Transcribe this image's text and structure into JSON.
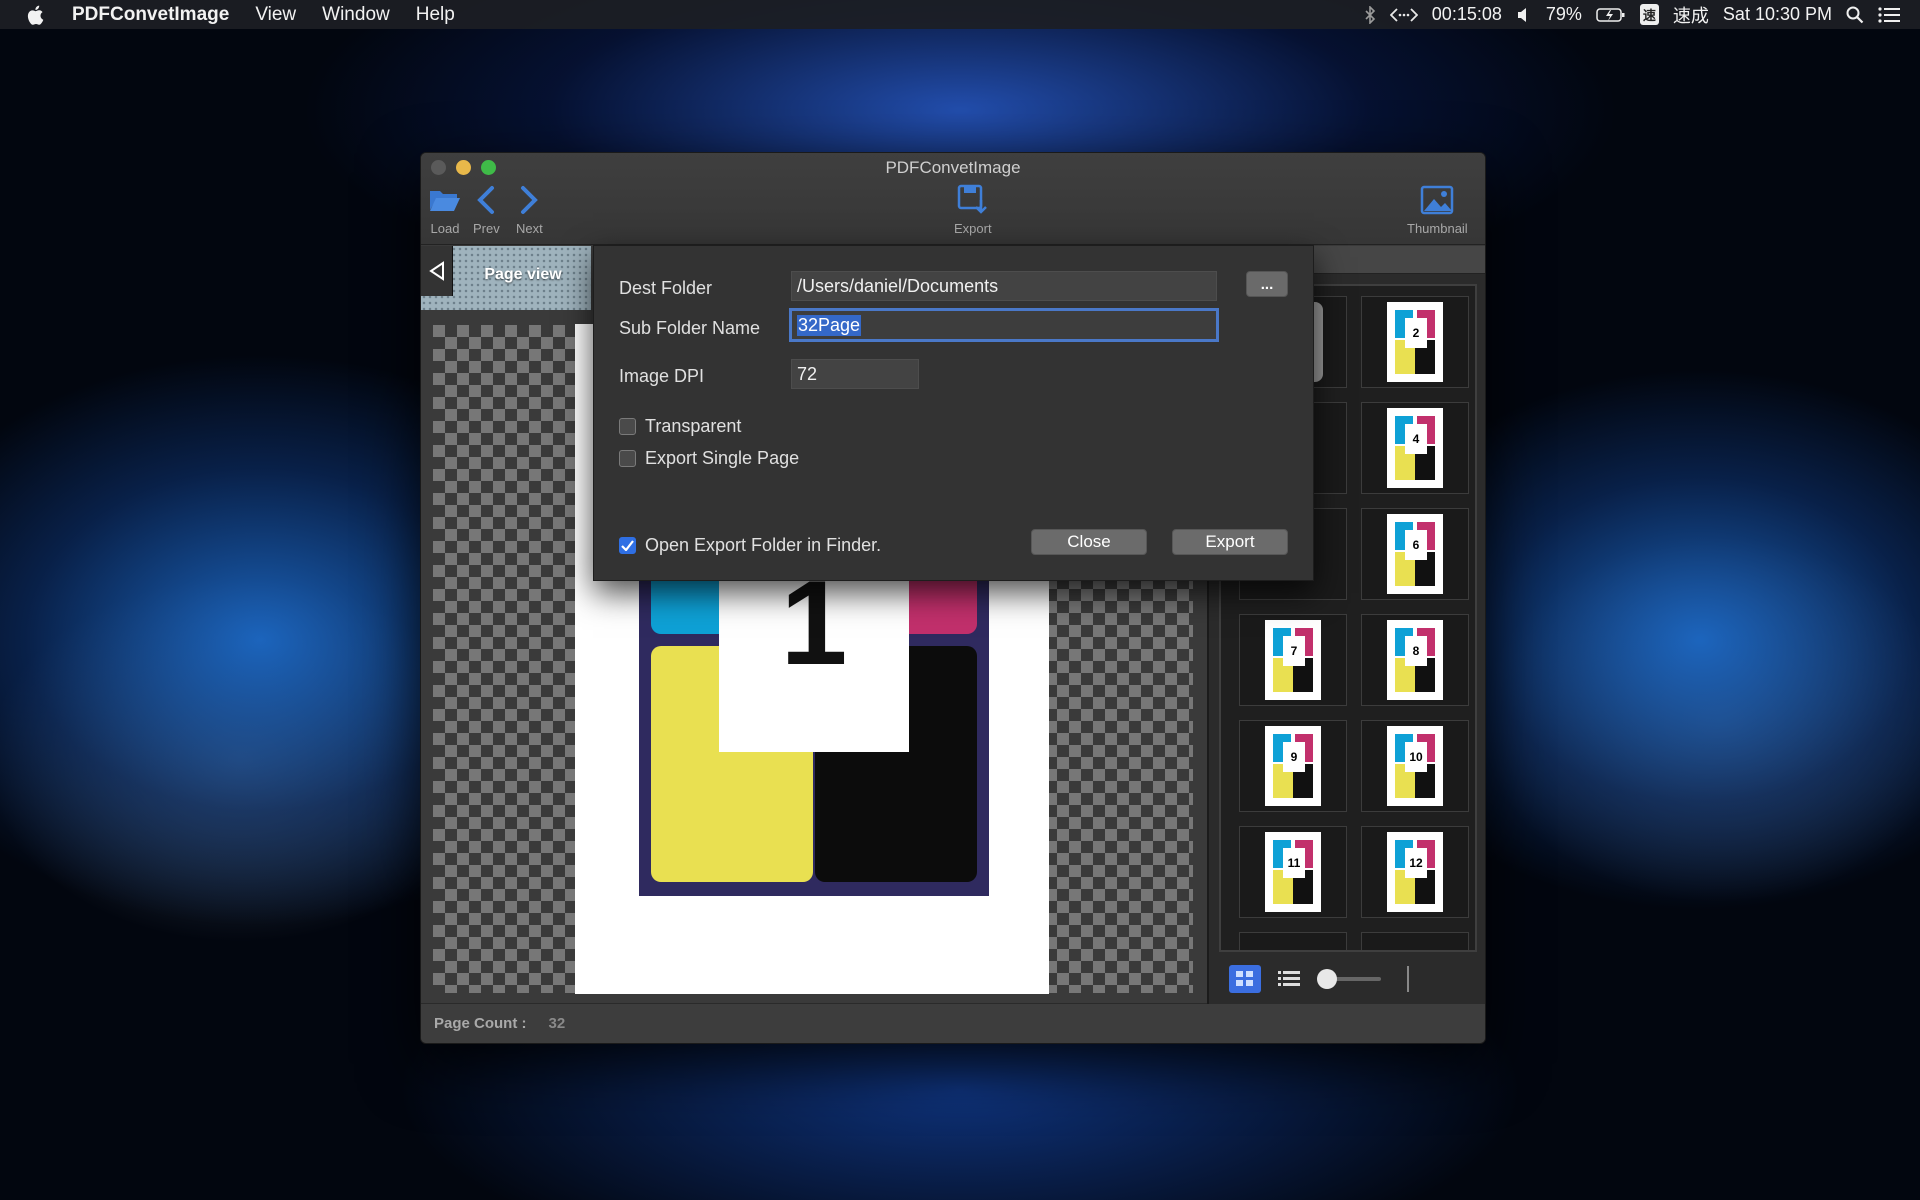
{
  "menubar": {
    "app_name": "PDFConvetImage",
    "menus": [
      "View",
      "Window",
      "Help"
    ],
    "timer": "00:15:08",
    "battery": "79%",
    "ime_badge": "速",
    "ime_label": "速成",
    "clock": "Sat 10:30 PM"
  },
  "window": {
    "title": "PDFConvetImage",
    "toolbar": {
      "load": "Load",
      "prev": "Prev",
      "next": "Next",
      "export": "Export",
      "thumbnail": "Thumbnail"
    },
    "page_view_tab": "Page view",
    "preview_page_number": "1",
    "thumbnail_header": "Thumbnail",
    "thumbnails": [
      "2",
      "4",
      "6",
      "7",
      "8",
      "9",
      "10",
      "11",
      "12"
    ],
    "status": {
      "label": "Page Count :",
      "value": "32"
    }
  },
  "export_sheet": {
    "dest_folder_label": "Dest Folder",
    "dest_folder_value": "/Users/daniel/Documents",
    "browse_label": "...",
    "sub_folder_label": "Sub Folder Name",
    "sub_folder_value": "32Page",
    "dpi_label": "Image DPI",
    "dpi_value": "72",
    "transparent_label": "Transparent",
    "transparent_checked": false,
    "single_page_label": "Export Single Page",
    "single_page_checked": false,
    "open_finder_label": "Open Export Folder in Finder.",
    "open_finder_checked": true,
    "close_label": "Close",
    "export_label": "Export"
  },
  "colors": {
    "accent": "#2f6fe4",
    "toolbar_icon": "#3f7fd8",
    "cyan": "#0ea1d6",
    "magenta": "#c2306c",
    "yellow": "#e9e051",
    "black": "#0c0c0c"
  }
}
